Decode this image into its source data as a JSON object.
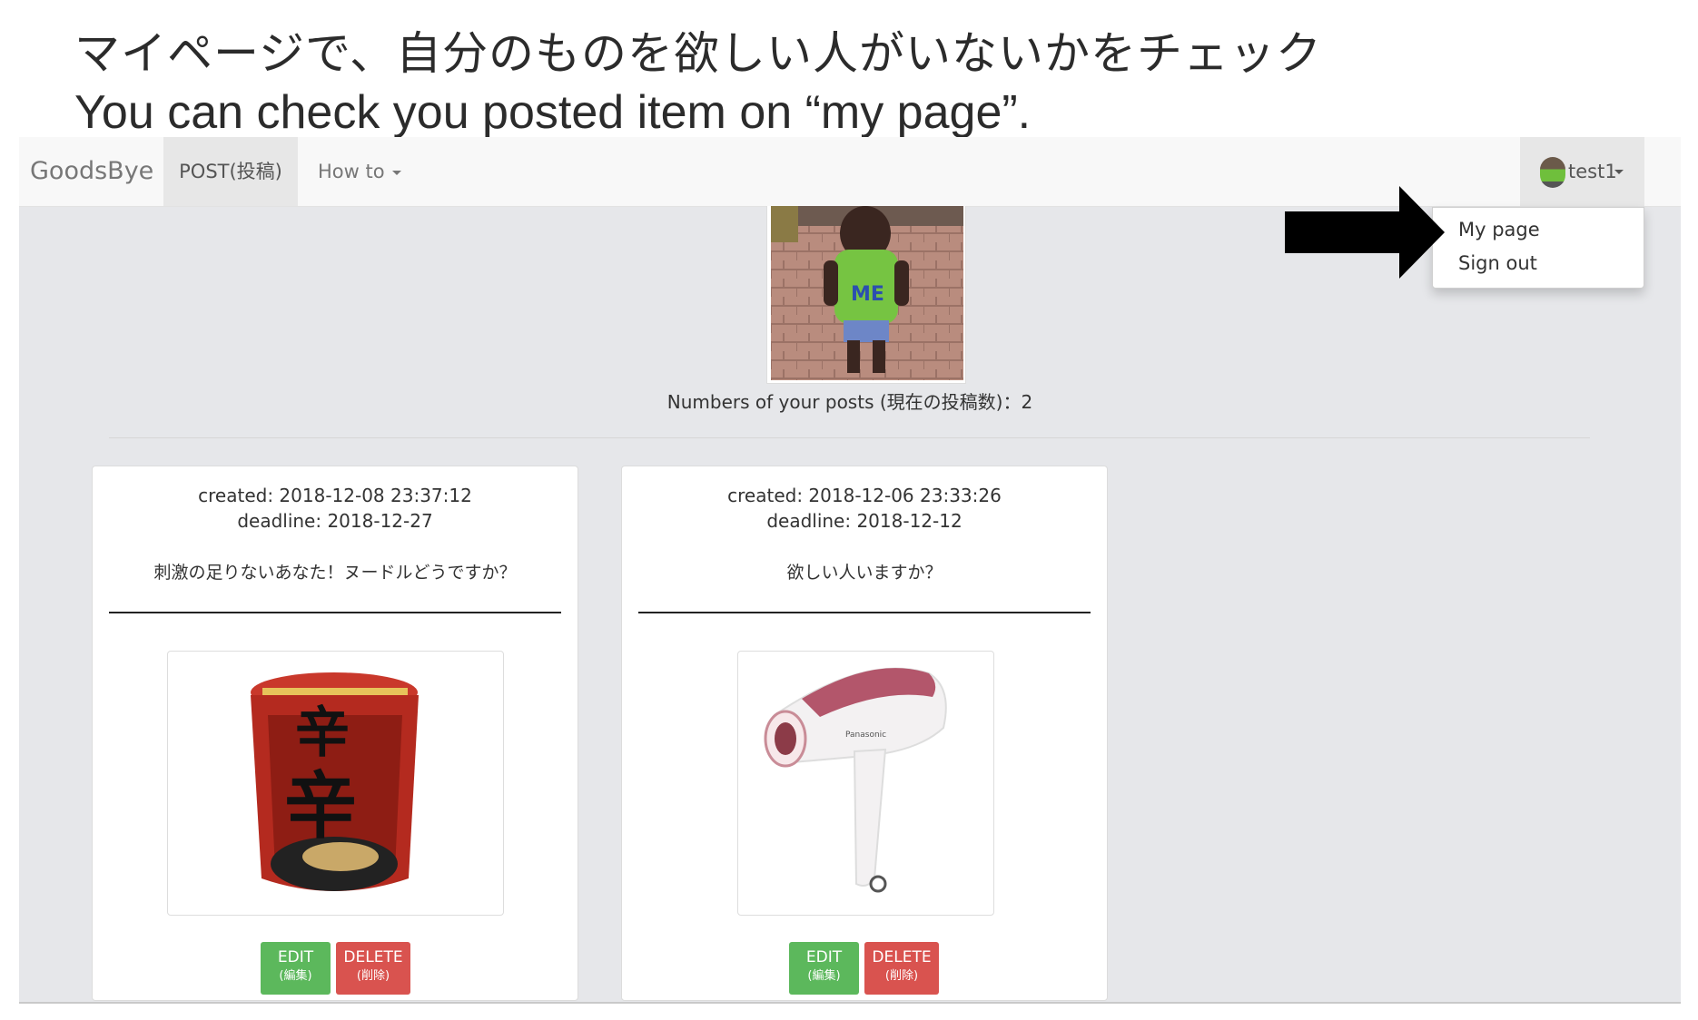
{
  "caption": {
    "japanese": "マイページで、自分のものを欲しい人がいないかをチェック",
    "english": "You can check you posted item on “my page”."
  },
  "navbar": {
    "brand": "GoodsBye",
    "post_label": "POST(投稿)",
    "howto_label": "How to",
    "user_label": "test1"
  },
  "dropdown": {
    "items": [
      {
        "label": "My page"
      },
      {
        "label": "Sign out"
      }
    ]
  },
  "profile": {
    "post_count_text": "Numbers of your posts (現在の投稿数)：2"
  },
  "posts": [
    {
      "created": "created: 2018-12-08 23:37:12",
      "deadline": "deadline: 2018-12-27",
      "message": "刺激の足りないあなた！ヌードルどうですか？",
      "image_icon": "ramen-cup-image",
      "edit_label": "EDIT",
      "edit_sub": "(編集)",
      "delete_label": "DELETE",
      "delete_sub": "(削除)"
    },
    {
      "created": "created: 2018-12-06 23:33:26",
      "deadline": "deadline: 2018-12-12",
      "message": "欲しい人いますか？",
      "image_icon": "hair-dryer-image",
      "edit_label": "EDIT",
      "edit_sub": "(編集)",
      "delete_label": "DELETE",
      "delete_sub": "(削除)"
    }
  ],
  "colors": {
    "edit": "#5cb85c",
    "delete": "#d9534f",
    "page_bg": "#e6e7ea",
    "navbar_bg": "#f8f8f8"
  }
}
